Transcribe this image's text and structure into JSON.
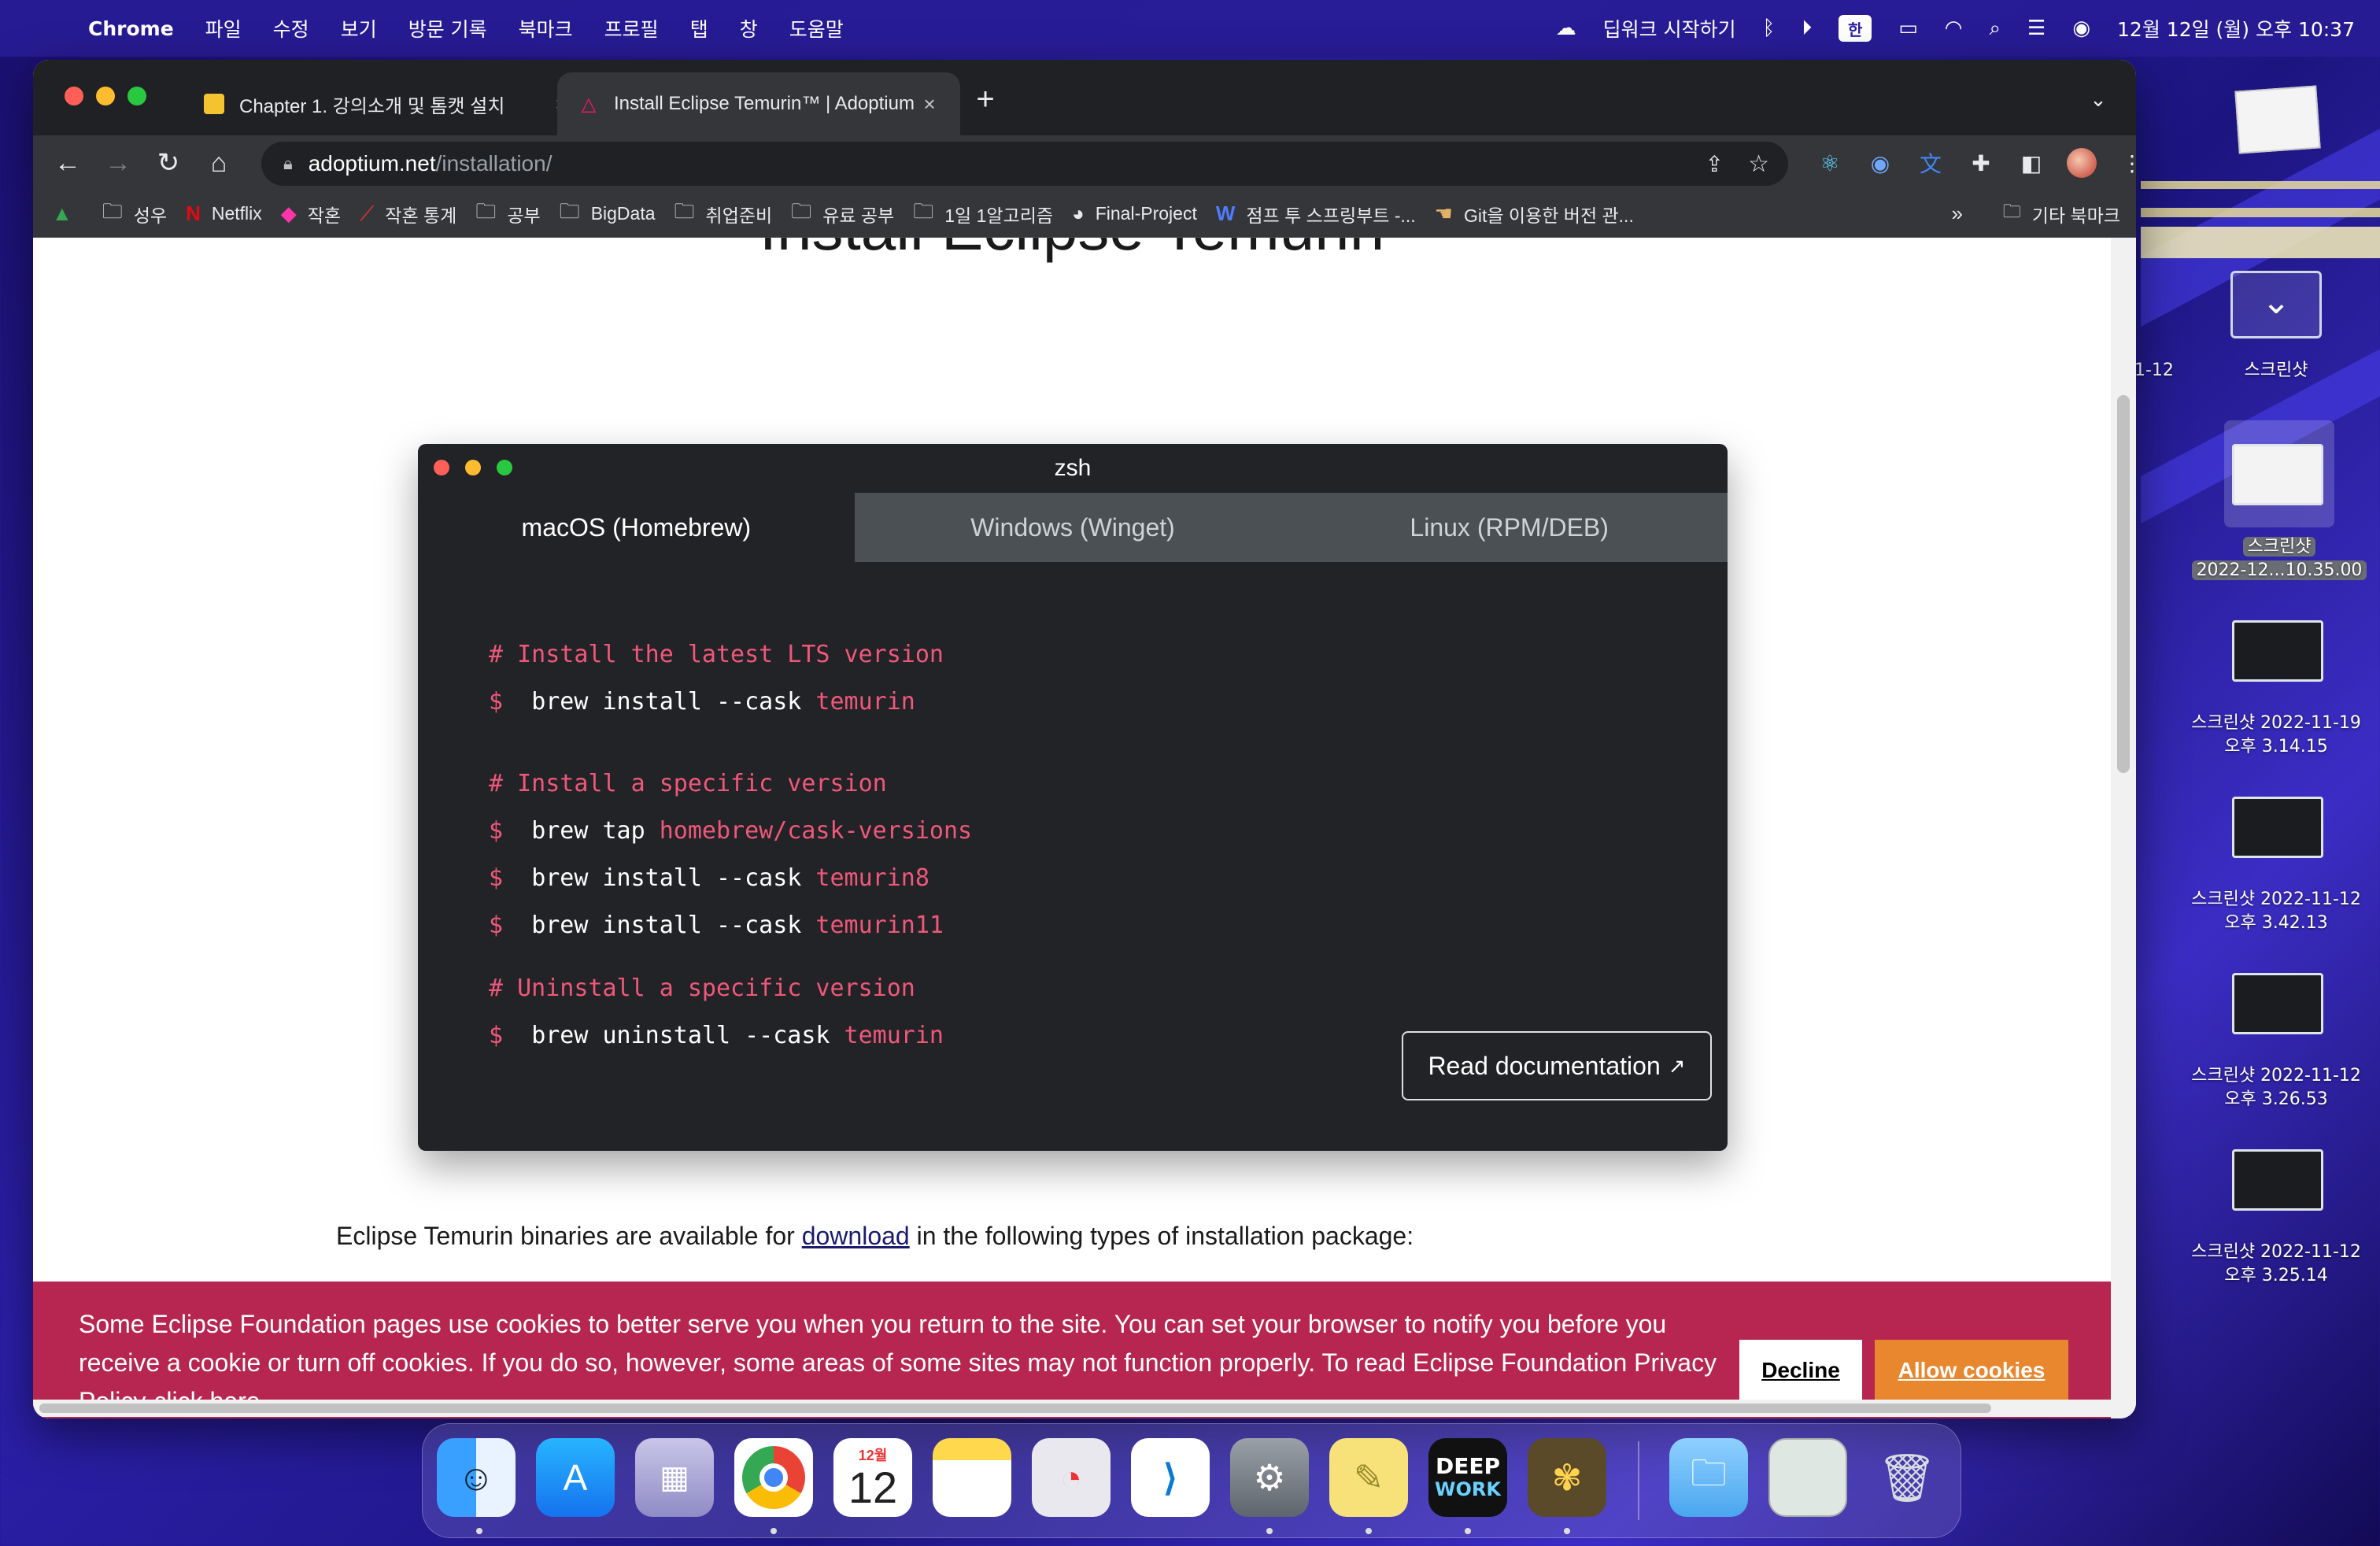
{
  "menubar": {
    "app": "Chrome",
    "items": [
      "파일",
      "수정",
      "보기",
      "방문 기록",
      "북마크",
      "프로필",
      "탭",
      "창",
      "도움말"
    ],
    "deepwork": "딥워크 시작하기",
    "input_mode": "한",
    "datetime": "12월 12일 (월) 오후 10:37"
  },
  "browser": {
    "tabs": [
      {
        "title": "Chapter 1. 강의소개 및 톰캣 설치"
      },
      {
        "title": "Install Eclipse Temurin™ | Adoptium"
      }
    ],
    "url_host": "adoptium.net",
    "url_path": "/installation/",
    "bookmarks": [
      "성우",
      "Netflix",
      "작혼",
      "작혼 통계",
      "공부",
      "BigData",
      "취업준비",
      "유료 공부",
      "1일 1알고리즘",
      "Final-Project",
      "점프 투 스프링부트 -...",
      "Git을 이용한 버전 관..."
    ],
    "bookmarks_more": "»",
    "other_bookmarks": "기타 북마크"
  },
  "page": {
    "heading": "Install Eclipse Temurin",
    "terminal": {
      "title": "zsh",
      "tabs": [
        "macOS (Homebrew)",
        "Windows (Winget)",
        "Linux (RPM/DEB)"
      ],
      "active_tab": 0,
      "code": {
        "c1": "# Install the latest LTS version",
        "l1_cmd": "brew install --cask ",
        "l1_arg": "temurin",
        "c2": "# Install a specific version",
        "l2_cmd": "brew tap ",
        "l2_arg": "homebrew/cask-versions",
        "l3_cmd": "brew install --cask ",
        "l3_arg": "temurin8",
        "l4_cmd": "brew install --cask ",
        "l4_arg": "temurin11",
        "c3": "# Uninstall a specific version",
        "l5_cmd": "brew uninstall --cask ",
        "l5_arg": "temurin",
        "prompt": "$"
      },
      "read_doc": "Read documentation"
    },
    "intro_before": "Eclipse Temurin binaries are available for ",
    "intro_link": "download",
    "intro_after": " in the following types of installation package:"
  },
  "cookie": {
    "message": "Some Eclipse Foundation pages use cookies to better serve you when you return to the site. You can set your browser to notify you before you receive a cookie or turn off cookies. If you do so, however, some areas of some sites may not function properly. To read Eclipse Foundation Privacy Policy",
    "link": "click here.",
    "decline": "Decline",
    "allow": "Allow cookies"
  },
  "desktop": {
    "partial_label": "1-12",
    "folder_label": "스크린샷",
    "selected": {
      "line1": "스크린샷",
      "line2": "2022-12...10.35.00"
    },
    "shots": [
      {
        "line1": "스크린샷 2022-11-19",
        "line2": "오후 3.14.15"
      },
      {
        "line1": "스크린샷 2022-11-12",
        "line2": "오후 3.42.13"
      },
      {
        "line1": "스크린샷 2022-11-12",
        "line2": "오후 3.26.53"
      },
      {
        "line1": "스크린샷 2022-11-12",
        "line2": "오후 3.25.14"
      }
    ]
  },
  "dock": {
    "calendar_month": "12월",
    "calendar_day": "12",
    "deepwork_l1": "DEEP",
    "deepwork_l2": "WORK"
  },
  "colors": {
    "accent_pink": "#f0587a",
    "cookie_bg": "#b72651",
    "allow_btn": "#e8872e"
  }
}
